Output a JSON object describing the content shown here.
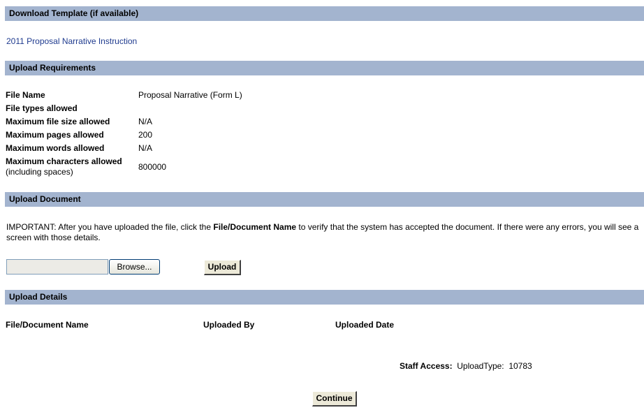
{
  "download_template": {
    "header": "Download Template (if available)",
    "link": "2011 Proposal Narrative Instruction"
  },
  "upload_requirements": {
    "header": "Upload Requirements",
    "rows": [
      {
        "label": "File Name",
        "value": "Proposal Narrative (Form L)"
      },
      {
        "label": "File types allowed",
        "value": ""
      },
      {
        "label": "Maximum file size allowed",
        "value": "N/A"
      },
      {
        "label": "Maximum pages allowed",
        "value": "200"
      },
      {
        "label": "Maximum words allowed",
        "value": "N/A"
      },
      {
        "label": "Maximum characters allowed",
        "sublabel": "(including spaces)",
        "value": "800000"
      }
    ]
  },
  "upload_document": {
    "header": "Upload Document",
    "important_prefix": "IMPORTANT: After you have uploaded the file, click the ",
    "important_bold": "File/Document Name",
    "important_suffix": " to verify that the system has accepted the document. If there were any errors, you will see a screen with those details.",
    "file_input_value": "",
    "browse_label": "Browse...",
    "upload_label": "Upload"
  },
  "upload_details": {
    "header": "Upload Details",
    "columns": [
      "File/Document Name",
      "Uploaded By",
      "Uploaded Date"
    ]
  },
  "staff_access": {
    "label": "Staff Access:",
    "upload_type_label": "UploadType:",
    "upload_type_value": "10783"
  },
  "continue_label": "Continue",
  "colors": {
    "section_bar": "#a3b4cf",
    "link": "#1f3b8f",
    "button_face": "#ece9d8"
  }
}
